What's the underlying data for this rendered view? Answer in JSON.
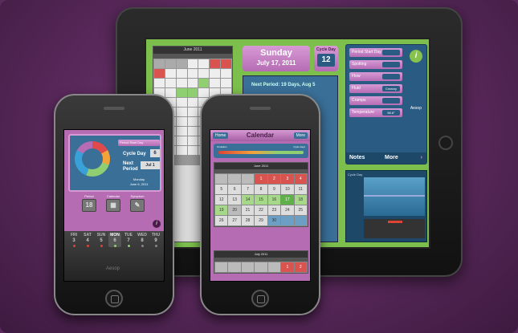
{
  "colors": {
    "accent_purple": "#b56cb3",
    "panel_blue": "#3a6f98",
    "ipad_green": "#7cbf4c",
    "period_red": "#d9534f",
    "fertile_green": "#8fcf72"
  },
  "ipad": {
    "calendar_header": "June 2011",
    "date_day": "Sunday",
    "date_full": "July 17, 2011",
    "cycle_label": "Cycle Day",
    "cycle_value": "12",
    "next_period_label": "Next Period:",
    "next_period_value": "19 Days, Aug 5",
    "settings": [
      {
        "label": "Period Start Day",
        "toggle": ""
      },
      {
        "label": "Spotting",
        "toggle": ""
      },
      {
        "label": "Flow",
        "toggle": ""
      },
      {
        "label": "Fluid",
        "toggle": "Creamy"
      },
      {
        "label": "Cramps",
        "toggle": ""
      },
      {
        "label": "Temperature",
        "toggle": "98.6°"
      }
    ],
    "info_icon": "info-icon",
    "brand": "Aesop",
    "notes_label": "Notes",
    "more_label": "More",
    "graph_label": "Cycle Day"
  },
  "phone_left": {
    "period_start_label": "Period Start Day",
    "cycle_label": "Cycle Day",
    "cycle_value": "6",
    "next_label": "Next\nPeriod",
    "next_value": "Jul 1",
    "today_day": "Monday",
    "today_date": "June 6, 2011",
    "tabs": [
      {
        "label": "Period",
        "glyph": "18"
      },
      {
        "label": "Calendar",
        "glyph": "▦"
      },
      {
        "label": "Symptom",
        "glyph": "✎"
      }
    ],
    "picker_days": [
      {
        "dow": "FRI",
        "num": "3",
        "dot": "#d43"
      },
      {
        "dow": "SAT",
        "num": "4",
        "dot": "#d43"
      },
      {
        "dow": "SUN",
        "num": "5",
        "dot": "#d43"
      },
      {
        "dow": "MON",
        "num": "6",
        "dot": "#8fcf72"
      },
      {
        "dow": "TUE",
        "num": "7",
        "dot": "#8fcf72"
      },
      {
        "dow": "WED",
        "num": "8",
        "dot": "#888"
      },
      {
        "dow": "THU",
        "num": "9",
        "dot": "#888"
      }
    ],
    "brand": "Aesop"
  },
  "phone_right": {
    "home_label": "Home",
    "title": "Calendar",
    "more_label": "More",
    "slider_left": "Ovulation",
    "slider_right": "Cycle days",
    "month1": "June 2011",
    "month1_cells": [
      {
        "t": "",
        "c": "e"
      },
      {
        "t": "",
        "c": "e"
      },
      {
        "t": "",
        "c": "e"
      },
      {
        "t": "1",
        "c": "r"
      },
      {
        "t": "2",
        "c": "r"
      },
      {
        "t": "3",
        "c": "r"
      },
      {
        "t": "4",
        "c": "r"
      },
      {
        "t": "5",
        "c": ""
      },
      {
        "t": "6",
        "c": ""
      },
      {
        "t": "7",
        "c": ""
      },
      {
        "t": "8",
        "c": ""
      },
      {
        "t": "9",
        "c": ""
      },
      {
        "t": "10",
        "c": ""
      },
      {
        "t": "11",
        "c": ""
      },
      {
        "t": "12",
        "c": ""
      },
      {
        "t": "13",
        "c": ""
      },
      {
        "t": "14",
        "c": "g"
      },
      {
        "t": "15",
        "c": "g"
      },
      {
        "t": "16",
        "c": "g"
      },
      {
        "t": "17",
        "c": "gg"
      },
      {
        "t": "18",
        "c": "g"
      },
      {
        "t": "19",
        "c": "g"
      },
      {
        "t": "20",
        "c": "e"
      },
      {
        "t": "21",
        "c": ""
      },
      {
        "t": "22",
        "c": ""
      },
      {
        "t": "23",
        "c": ""
      },
      {
        "t": "24",
        "c": ""
      },
      {
        "t": "25",
        "c": ""
      },
      {
        "t": "26",
        "c": ""
      },
      {
        "t": "27",
        "c": ""
      },
      {
        "t": "28",
        "c": ""
      },
      {
        "t": "29",
        "c": ""
      },
      {
        "t": "30",
        "c": "b"
      },
      {
        "t": "",
        "c": "b"
      },
      {
        "t": "",
        "c": "b"
      }
    ],
    "month2": "July 2011",
    "month2_cells": [
      {
        "t": "",
        "c": "e"
      },
      {
        "t": "",
        "c": "e"
      },
      {
        "t": "",
        "c": "e"
      },
      {
        "t": "",
        "c": "e"
      },
      {
        "t": "",
        "c": "e"
      },
      {
        "t": "1",
        "c": "r"
      },
      {
        "t": "2",
        "c": "r"
      }
    ]
  }
}
